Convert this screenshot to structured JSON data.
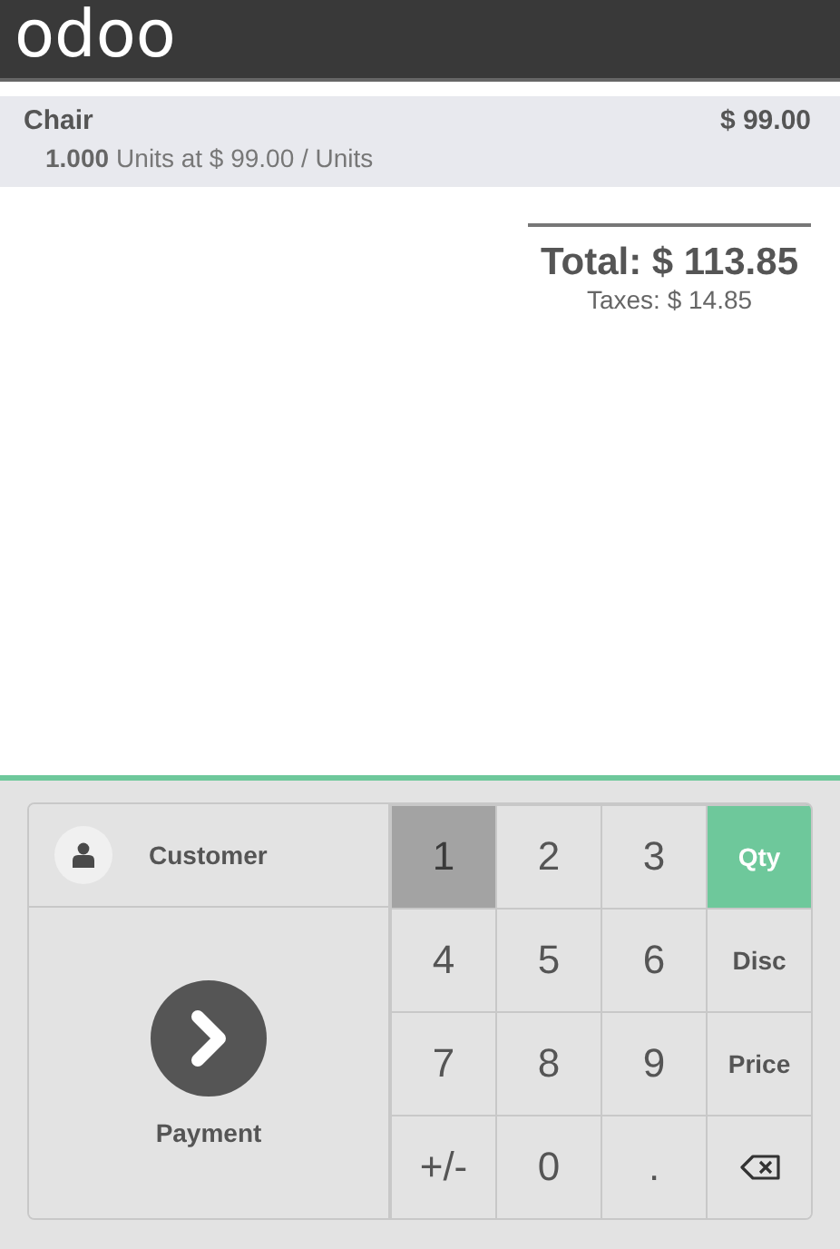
{
  "header": {
    "logo": "odoo"
  },
  "order": {
    "lines": [
      {
        "product": "Chair",
        "price": "$ 99.00",
        "quantity": "1.000",
        "detail": "Units at $ 99.00 / Units",
        "selected": true
      }
    ],
    "total": "Total: $ 113.85",
    "taxes": "Taxes: $ 14.85"
  },
  "actions": {
    "customer": "Customer",
    "payment": "Payment"
  },
  "keypad": [
    {
      "kind": "digit",
      "label": "1",
      "pressed": true
    },
    {
      "kind": "digit",
      "label": "2",
      "pressed": false
    },
    {
      "kind": "digit",
      "label": "3",
      "pressed": false
    },
    {
      "kind": "mode",
      "label": "Qty",
      "selected": true
    },
    {
      "kind": "digit",
      "label": "4",
      "pressed": false
    },
    {
      "kind": "digit",
      "label": "5",
      "pressed": false
    },
    {
      "kind": "digit",
      "label": "6",
      "pressed": false
    },
    {
      "kind": "mode",
      "label": "Disc",
      "selected": false
    },
    {
      "kind": "digit",
      "label": "7",
      "pressed": false
    },
    {
      "kind": "digit",
      "label": "8",
      "pressed": false
    },
    {
      "kind": "digit",
      "label": "9",
      "pressed": false
    },
    {
      "kind": "mode",
      "label": "Price",
      "selected": false
    },
    {
      "kind": "digit",
      "label": "+/-",
      "pressed": false
    },
    {
      "kind": "digit",
      "label": "0",
      "pressed": false
    },
    {
      "kind": "digit",
      "label": ".",
      "pressed": false
    },
    {
      "kind": "backspace"
    }
  ]
}
